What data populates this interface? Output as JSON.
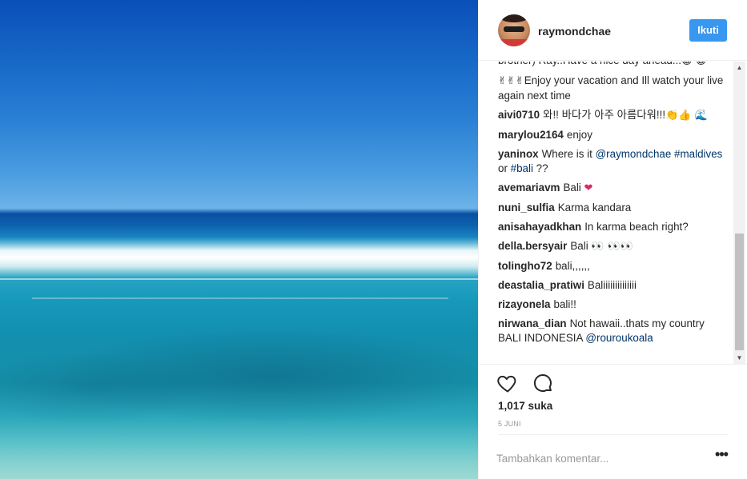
{
  "header": {
    "username": "raymondchae",
    "follow_label": "Ikuti"
  },
  "comments": [
    {
      "user": "",
      "parts": [
        {
          "t": "brother) Ray..Have a nice day ahead..."
        },
        {
          "t": "😁 😁",
          "e": true
        }
      ]
    },
    {
      "user": "",
      "parts": [
        {
          "t": "✌✌✌",
          "e": true
        },
        {
          "t": "Enjoy your vacation and Ill watch your live again next time"
        }
      ]
    },
    {
      "user": "aivi0710",
      "parts": [
        {
          "t": "와!! 바다가 아주 아름다워!!!"
        },
        {
          "t": "👏👍 🌊",
          "e": true
        }
      ]
    },
    {
      "user": "marylou2164",
      "parts": [
        {
          "t": "enjoy"
        }
      ]
    },
    {
      "user": "yaninox",
      "parts": [
        {
          "t": "Where is it "
        },
        {
          "t": "@raymondchae",
          "m": true
        },
        {
          "t": " "
        },
        {
          "t": "#maldives",
          "m": true
        },
        {
          "t": " or "
        },
        {
          "t": "#bali",
          "m": true
        },
        {
          "t": " ??"
        }
      ]
    },
    {
      "user": "avemariavm",
      "parts": [
        {
          "t": "Bali "
        },
        {
          "t": "❤",
          "e": true,
          "c": "#e0245e"
        }
      ]
    },
    {
      "user": "nuni_sulfia",
      "parts": [
        {
          "t": "Karma kandara"
        }
      ]
    },
    {
      "user": "anisahayadkhan",
      "parts": [
        {
          "t": "In karma beach right?"
        }
      ]
    },
    {
      "user": "della.bersyair",
      "parts": [
        {
          "t": "Bali "
        },
        {
          "t": "👀 👀👀",
          "e": true
        }
      ]
    },
    {
      "user": "tolingho72",
      "parts": [
        {
          "t": "bali,,,,,,"
        }
      ]
    },
    {
      "user": "deastalia_pratiwi",
      "parts": [
        {
          "t": "Baliiiiiiiiiiiiii"
        }
      ]
    },
    {
      "user": "rizayonela",
      "parts": [
        {
          "t": "bali!!"
        }
      ]
    },
    {
      "user": "nirwana_dian",
      "parts": [
        {
          "t": "Not hawaii..thats my country BALI INDONESIA "
        },
        {
          "t": "@rouroukoala",
          "m": true
        }
      ]
    }
  ],
  "icons": {
    "like": "heart-outline-icon",
    "comment": "speech-bubble-icon",
    "more": "ellipsis-icon"
  },
  "likes_text": "1,017 suka",
  "date_text": "5 JUNI",
  "comment_input": {
    "placeholder": "Tambahkan komentar...",
    "value": ""
  },
  "more_label": "•••",
  "colors": {
    "follow_button": "#3897f0",
    "mention": "#003569",
    "text": "#262626",
    "muted": "#999999"
  }
}
